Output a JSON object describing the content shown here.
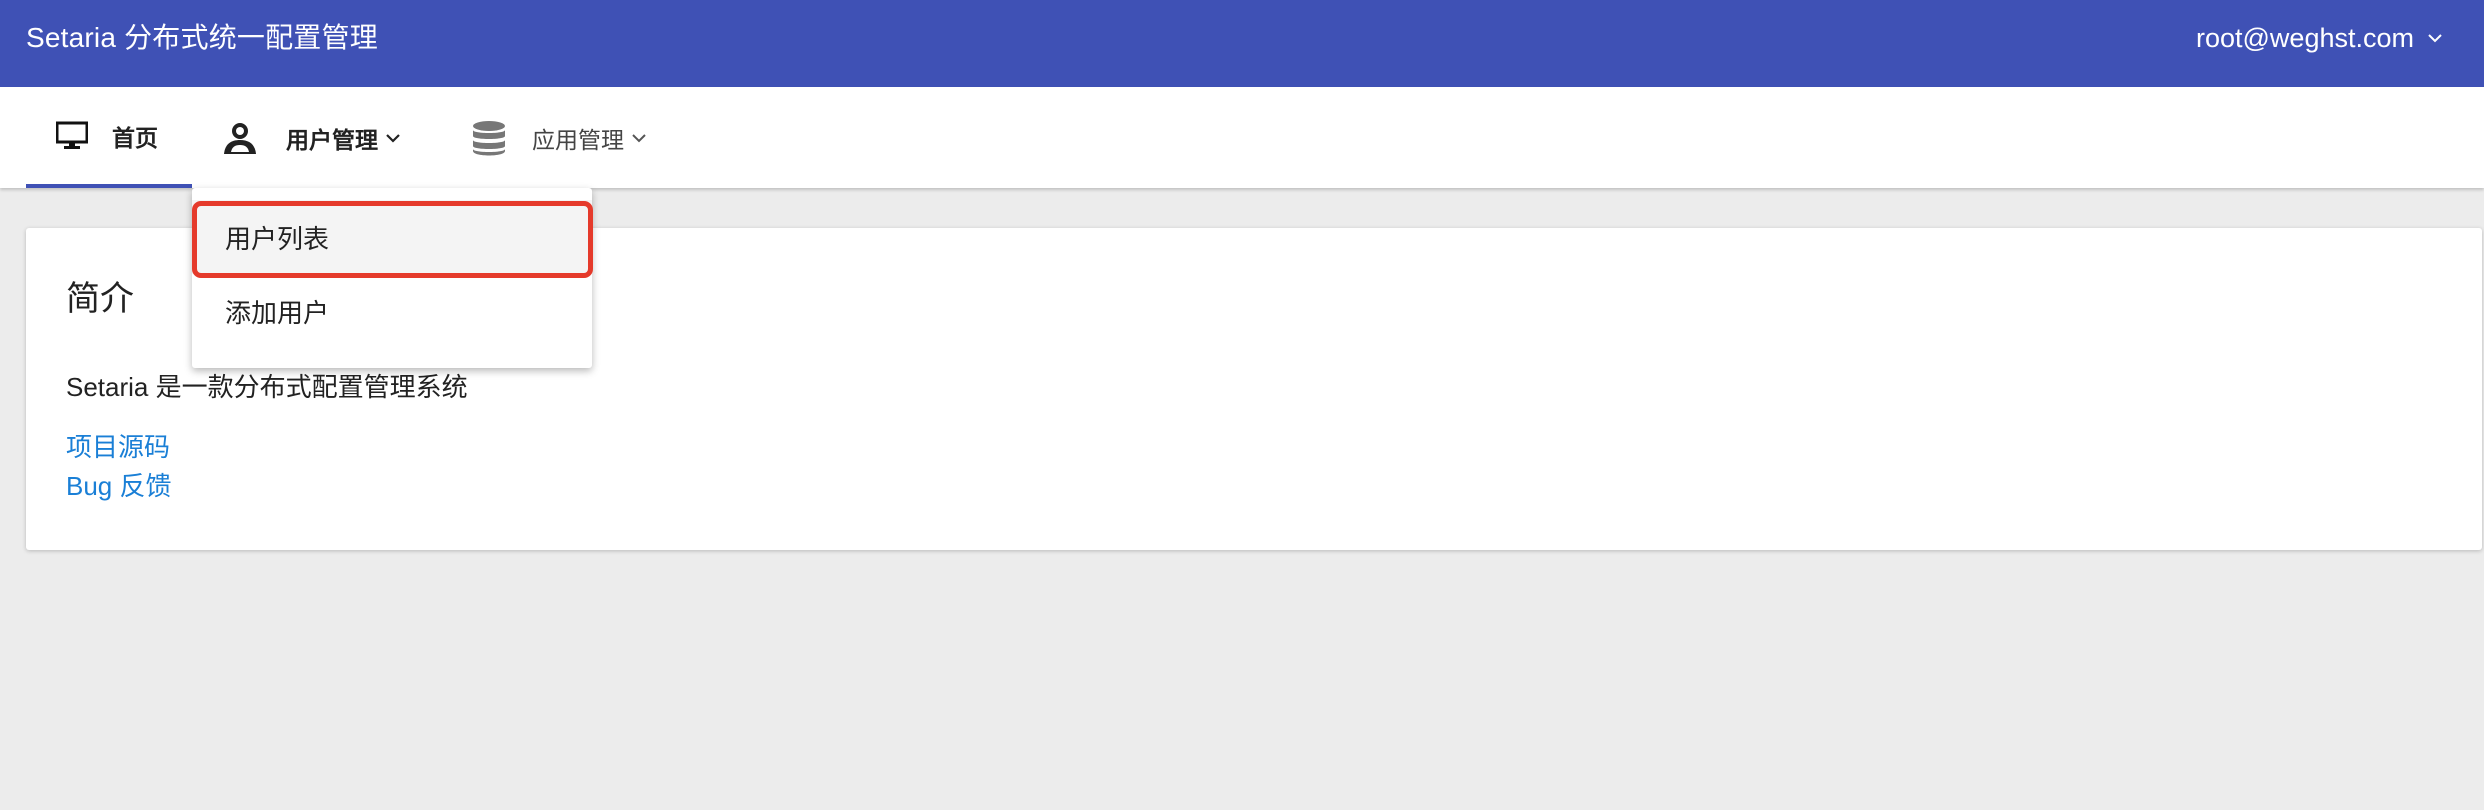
{
  "header": {
    "title": "Setaria 分布式统一配置管理",
    "user": "root@weghst.com",
    "user_icon": "chevron-down-icon"
  },
  "nav": {
    "home": {
      "label": "首页",
      "icon": "monitor-icon"
    },
    "users": {
      "label": "用户管理",
      "icon": "user-icon",
      "caret": "chevron-down-icon"
    },
    "apps": {
      "label": "应用管理",
      "icon": "database-icon",
      "caret": "chevron-down-icon"
    }
  },
  "dropdown": {
    "items": [
      {
        "label": "用户列表",
        "highlighted": true
      },
      {
        "label": "添加用户",
        "highlighted": false
      }
    ]
  },
  "card": {
    "title": "简介",
    "description": "Setaria 是一款分布式配置管理系统",
    "links": [
      {
        "label": "项目源码"
      },
      {
        "label": "Bug 反馈"
      }
    ]
  },
  "colors": {
    "header_bg": "#3f51b5",
    "page_bg": "#ececec",
    "link": "#1a7fd6",
    "highlight": "#e53a2b"
  }
}
